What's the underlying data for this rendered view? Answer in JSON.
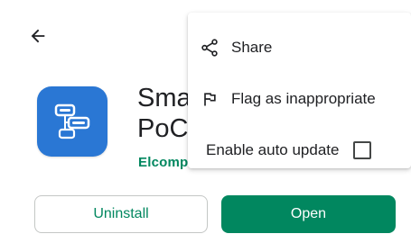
{
  "header": {
    "back_icon": "arrow-left-icon"
  },
  "app": {
    "title": "Sma\nPoC",
    "developer": "Elcomp",
    "icon": "app-logo-icon",
    "icon_color": "#2a77d4"
  },
  "buttons": {
    "uninstall_label": "Uninstall",
    "open_label": "Open"
  },
  "menu": {
    "items": [
      {
        "label": "Share",
        "icon": "share-icon"
      },
      {
        "label": "Flag as inappropriate",
        "icon": "flag-icon"
      },
      {
        "label": "Enable auto update",
        "checked": false
      }
    ]
  },
  "colors": {
    "accent": "#01875f",
    "text": "#202124"
  }
}
